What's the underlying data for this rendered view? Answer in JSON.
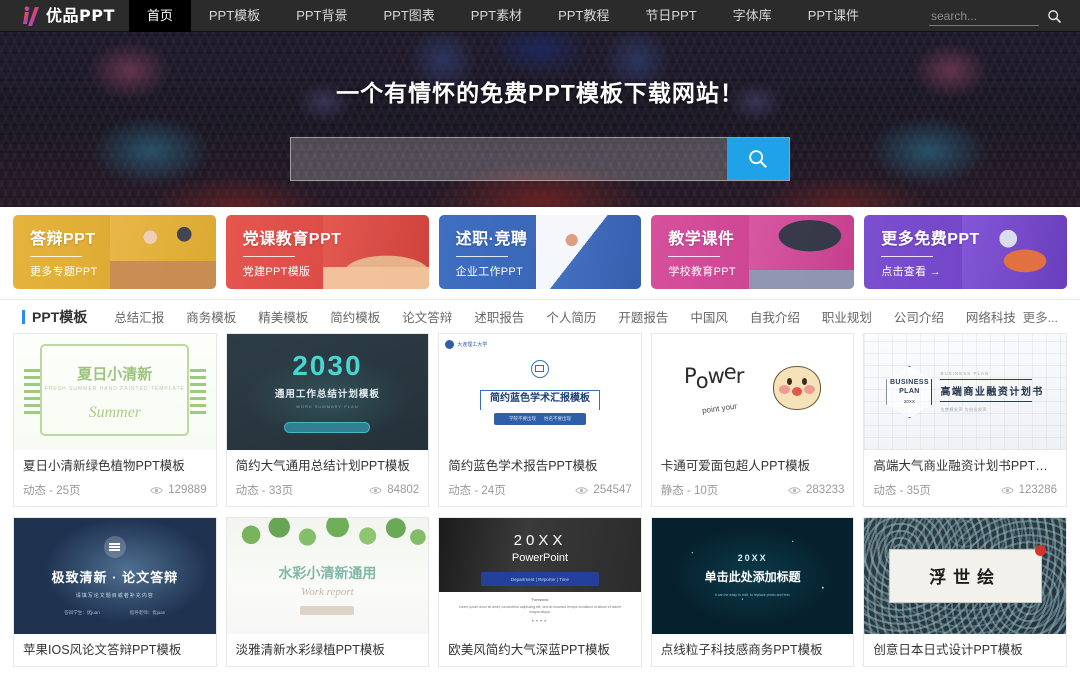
{
  "header": {
    "logo_text": "优品PPT",
    "nav": [
      {
        "label": "首页",
        "active": true
      },
      {
        "label": "PPT模板",
        "active": false
      },
      {
        "label": "PPT背景",
        "active": false
      },
      {
        "label": "PPT图表",
        "active": false
      },
      {
        "label": "PPT素材",
        "active": false
      },
      {
        "label": "PPT教程",
        "active": false
      },
      {
        "label": "节日PPT",
        "active": false
      },
      {
        "label": "字体库",
        "active": false
      },
      {
        "label": "PPT课件",
        "active": false
      }
    ],
    "search": {
      "value": "",
      "placeholder": "search..."
    }
  },
  "hero": {
    "title": "一个有情怀的免费PPT模板下载网站！",
    "search": {
      "value": "",
      "placeholder": ""
    }
  },
  "banners": [
    {
      "title": "答辩PPT",
      "subtitle": "更多专题PPT",
      "color": "#ddab33"
    },
    {
      "title": "党课教育PPT",
      "subtitle": "党建PPT模版",
      "color": "#dd4b46"
    },
    {
      "title": "述职·竞聘",
      "subtitle": "企业工作PPT",
      "color": "#3a66b6"
    },
    {
      "title": "教学课件",
      "subtitle": "学校教育PPT",
      "color": "#cd4694"
    },
    {
      "title": "更多免费PPT",
      "subtitle": "点击查看 →",
      "color": "#7246c6"
    }
  ],
  "section": {
    "title": "PPT模板",
    "accent_color": "#2d8cf0",
    "links": [
      "总结汇报",
      "商务模板",
      "精美模板",
      "简约模板",
      "论文答辩",
      "述职报告",
      "个人简历",
      "开题报告",
      "中国风",
      "自我介绍",
      "职业规划",
      "公司介绍",
      "网络科技"
    ],
    "more": "更多..."
  },
  "cards": [
    {
      "title": "夏日小清新绿色植物PPT模板",
      "type": "动态",
      "pages": "25页",
      "meta": "动态 - 25页",
      "views": "129889",
      "thumb": {
        "style": "t-summer",
        "cn": "夏日小清新",
        "en": "FRESH SUMMER HAND PAINTED TEMPLATE",
        "sig": "Summer"
      }
    },
    {
      "title": "简约大气通用总结计划PPT模板",
      "type": "动态",
      "pages": "33页",
      "meta": "动态 - 33页",
      "views": "84802",
      "thumb": {
        "style": "t-2030",
        "big": "2030",
        "sub": "通用工作总结计划模板",
        "tiny": "WORK SUMMARY PLAN"
      }
    },
    {
      "title": "简约蓝色学术报告PPT模板",
      "type": "动态",
      "pages": "24页",
      "meta": "动态 - 24页",
      "views": "254547",
      "thumb": {
        "style": "t-acad",
        "crest": "大连理工大学",
        "ttl": "简约蓝色学术汇报模板",
        "bar1": "学院不要出现",
        "bar2": "姓名不要出现"
      }
    },
    {
      "title": "卡通可爱面包超人PPT模板",
      "type": "静态",
      "pages": "10页",
      "meta": "静态 - 10页",
      "views": "283233",
      "thumb": {
        "style": "t-power",
        "word": "Power",
        "sub": "point your"
      }
    },
    {
      "title": "高端大气商业融资计划书PPT模板",
      "type": "动态",
      "pages": "35页",
      "meta": "动态 - 35页",
      "views": "123286",
      "thumb": {
        "style": "t-biz",
        "hex1": "BUSINESS",
        "hex2": "PLAN",
        "hex3": "20XX",
        "small": "BUSINESS PLAN",
        "ttl": "高端商业融资计划书",
        "sub": "为梦想发声   为创业发声"
      }
    },
    {
      "title": "苹果IOS风论文答辩PPT模板",
      "type": "",
      "pages": "",
      "meta": "",
      "views": "",
      "thumb": {
        "style": "t-ios",
        "h": "极致清新 · 论文答辩",
        "s": "请填写论文题目或者补充内容",
        "f1": "答辩学生：优juan",
        "f2": "指导老师：优juan"
      }
    },
    {
      "title": "淡雅清新水彩绿植PPT模板",
      "type": "",
      "pages": "",
      "meta": "",
      "views": "",
      "thumb": {
        "style": "t-water",
        "cn": "水彩小清新通用",
        "en": "Work report"
      }
    },
    {
      "title": "欧美风简约大气深蓝PPT模板",
      "type": "",
      "pages": "",
      "meta": "",
      "views": "",
      "thumb": {
        "style": "t-20xx",
        "a": "20XX",
        "b": "PowerPoint",
        "bar": "Department  |  Reporter  |  Time",
        "u": "Foreword",
        "p": "Lorem ipsum dolor sit amet, consectetur adipiscing elit, sed do eiusmod tempor incididunt ut labore et dolore magna aliqua."
      }
    },
    {
      "title": "点线粒子科技感商务PPT模板",
      "type": "",
      "pages": "",
      "meta": "",
      "views": "",
      "thumb": {
        "style": "t-part",
        "a": "20XX",
        "b": "单击此处添加标题",
        "c": "It can be easy to edit, to replace photo and text."
      }
    },
    {
      "title": "创意日本日式设计PPT模板",
      "type": "",
      "pages": "",
      "meta": "",
      "views": "",
      "thumb": {
        "style": "t-jp",
        "plate": "浮世绘"
      }
    }
  ]
}
